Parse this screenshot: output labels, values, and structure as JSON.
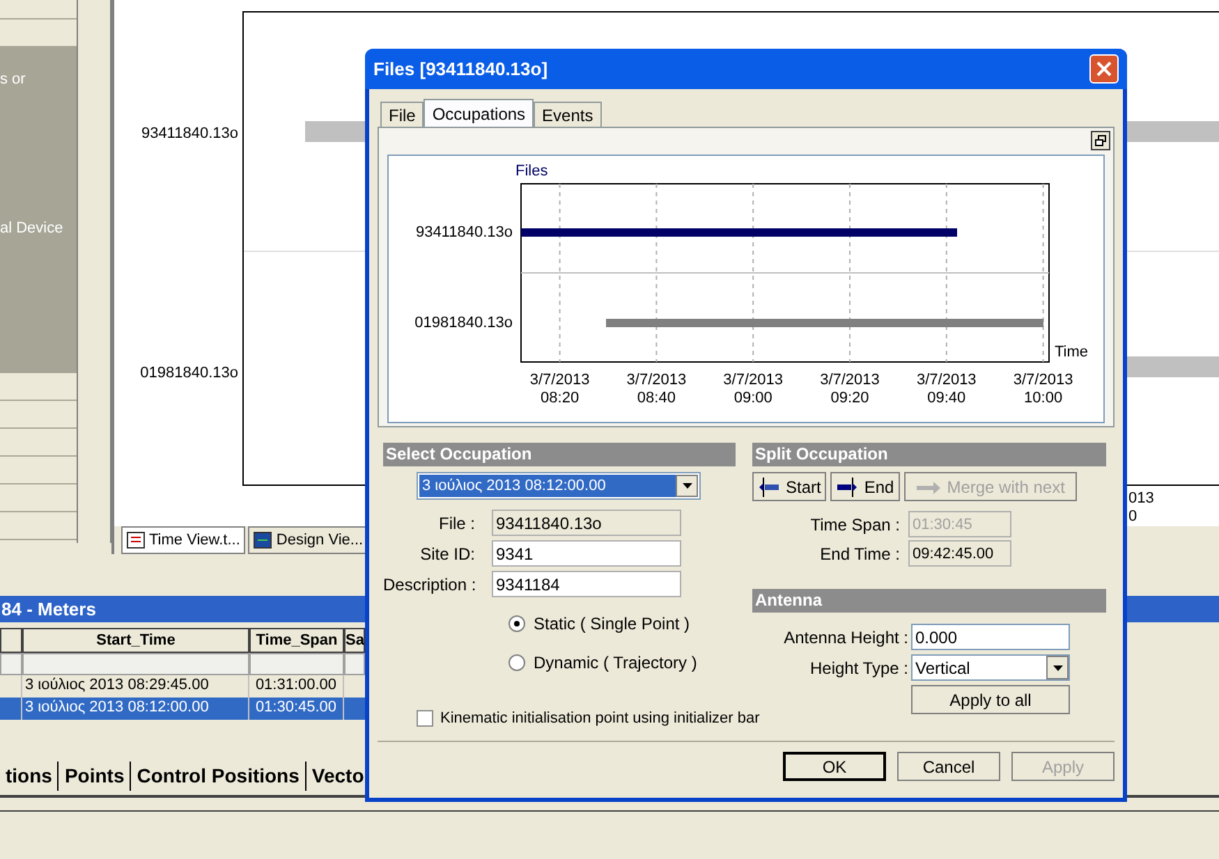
{
  "app": {
    "left_panel": {
      "texts": [
        "s or",
        "al Device"
      ]
    },
    "chart": {
      "rows": [
        "93411840.13o",
        "01981840.13o"
      ],
      "axis_texts": [
        "013",
        "0"
      ]
    },
    "view_tabs": [
      {
        "label": "Time View.t...",
        "selected": true
      },
      {
        "label": "Design Vie...",
        "selected": false
      }
    ]
  },
  "meters_panel": {
    "title": "84 - Meters",
    "columns": [
      "Start_Time",
      "Time_Span",
      "Sa"
    ],
    "rows": [
      {
        "cells": [
          "3 ιούλιος 2013 08:29:45.00",
          "01:31:00.00"
        ],
        "selected": false
      },
      {
        "cells": [
          "3 ιούλιος 2013 08:12:00.00",
          "01:30:45.00"
        ],
        "selected": true
      }
    ],
    "tabs": [
      "tions",
      "Points",
      "Control Positions",
      "Vecto"
    ]
  },
  "dialog": {
    "title": "Files [93411840.13o]",
    "tabs": [
      {
        "label": "File",
        "selected": false
      },
      {
        "label": "Occupations",
        "selected": true
      },
      {
        "label": "Events",
        "selected": false
      }
    ],
    "chart": {
      "ylabel": "Files",
      "xlabel": "Time",
      "rows": [
        {
          "label": "93411840.13o",
          "selected": true
        },
        {
          "label": "01981840.13o",
          "selected": false
        }
      ],
      "ticks": [
        "3/7/2013 08:20",
        "3/7/2013 08:40",
        "3/7/2013 09:00",
        "3/7/2013 09:20",
        "3/7/2013 09:40",
        "3/7/2013 10:00"
      ]
    },
    "select_occupation": {
      "header": "Select Occupation",
      "occupation": "3 ιούλιος 2013 08:12:00.00",
      "fields": [
        {
          "label": "File :",
          "value": "93411840.13o",
          "readonly": true
        },
        {
          "label": "Site ID:",
          "value": "9341",
          "readonly": false
        },
        {
          "label": "Description :",
          "value": "9341184",
          "readonly": false
        }
      ],
      "modes": [
        {
          "label": "Static ( Single Point )",
          "selected": true
        },
        {
          "label": "Dynamic ( Trajectory )",
          "selected": false
        }
      ],
      "kinematic": {
        "label": "Kinematic initialisation point using initializer bar",
        "checked": false
      }
    },
    "split_occupation": {
      "header": "Split Occupation",
      "buttons": [
        {
          "label": "Start",
          "kind": "start",
          "disabled": false
        },
        {
          "label": "End",
          "kind": "end",
          "disabled": false
        },
        {
          "label": "Merge with next",
          "kind": "merge",
          "disabled": true
        }
      ],
      "fields": [
        {
          "label": "Time Span :",
          "value": "01:30:45",
          "disabled": true
        },
        {
          "label": "End Time :",
          "value": "09:42:45.00",
          "disabled": false
        }
      ]
    },
    "antenna": {
      "header": "Antenna",
      "height": {
        "label": "Antenna Height :",
        "value": "0.000"
      },
      "height_type": {
        "label": "Height Type :",
        "value": "Vertical"
      },
      "apply_all": "Apply to all"
    },
    "buttons": [
      {
        "label": "OK",
        "default": true,
        "disabled": false
      },
      {
        "label": "Cancel",
        "default": false,
        "disabled": false
      },
      {
        "label": "Apply",
        "default": false,
        "disabled": true
      }
    ]
  }
}
